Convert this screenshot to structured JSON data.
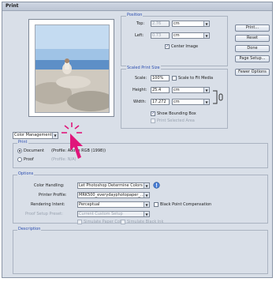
{
  "window": {
    "title": "Print"
  },
  "position": {
    "legend": "Position",
    "top_label": "Top:",
    "top_value": "2.76",
    "left_label": "Left:",
    "left_value": "0.73",
    "unit": "cm",
    "center_image_label": "Center Image"
  },
  "scaled": {
    "legend": "Scaled Print Size",
    "scale_label": "Scale:",
    "scale_value": "100%",
    "scale_to_fit_label": "Scale to Fit Media",
    "height_label": "Height:",
    "height_value": "25.4",
    "width_label": "Width:",
    "width_value": "17.272",
    "unit": "cm",
    "show_bbox_label": "Show Bounding Box",
    "print_sel_label": "Print Selected Area"
  },
  "buttons": {
    "print": "Print...",
    "reset": "Reset",
    "done": "Done",
    "page_setup": "Page Setup...",
    "fewer_options": "Fewer Options"
  },
  "color_mgmt": {
    "dropdown": "Color Management",
    "print_legend": "Print",
    "document_label": "Document",
    "document_profile": "(Profile: Adobe RGB (1998))",
    "proof_label": "Proof",
    "proof_profile": "(Profile: N/A)"
  },
  "options": {
    "legend": "Options",
    "color_handling_label": "Color Handling:",
    "color_handling_value": "Let Photoshop Determine Colors",
    "printer_profile_label": "Printer Profile:",
    "printer_profile_value": "MRK500_everydayphotopaper_...",
    "rendering_intent_label": "Rendering Intent:",
    "rendering_intent_value": "Perceptual",
    "bpc_label": "Black Point Compensation",
    "proof_setup_label": "Proof Setup Preset:",
    "proof_setup_value": "Current Custom Setup",
    "simulate_paper_label": "Simulate Paper Color",
    "simulate_ink_label": "Simulate Black Ink"
  },
  "description": {
    "legend": "Description"
  },
  "colors": {
    "accent": "#2a4db0",
    "annotation": "#e0157a"
  }
}
